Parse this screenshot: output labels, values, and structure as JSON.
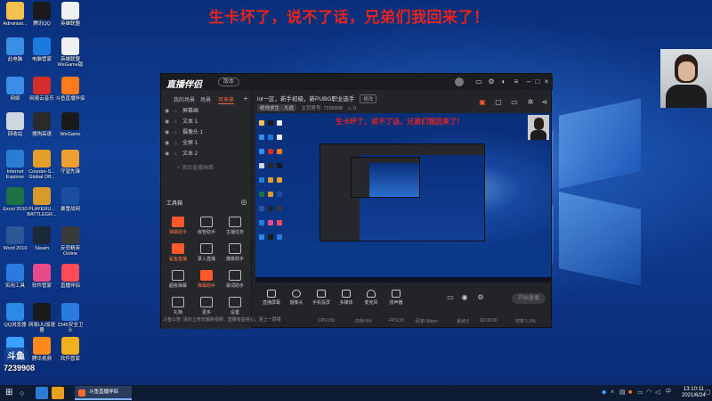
{
  "overlay": {
    "headline": "生卡坏了，说不了话，兄弟们我回来了！",
    "room_id": "7239908",
    "watermark_badge": "斗鱼"
  },
  "desktop": {
    "icons": [
      {
        "label": "Administr...",
        "icon": "user-folder-icon",
        "color": "#f2c14e"
      },
      {
        "label": "腾讯QQ",
        "icon": "qq-icon",
        "color": "#1a1a1a"
      },
      {
        "label": "英雄联盟",
        "icon": "document-icon",
        "color": "#f0f0f0"
      },
      {
        "label": "此电脑",
        "icon": "computer-icon",
        "color": "#3a8ee6"
      },
      {
        "label": "电脑管家",
        "icon": "shield-icon",
        "color": "#1b7ae0"
      },
      {
        "label": "英雄联盟 WeGame版",
        "icon": "document-icon",
        "color": "#f0f0f0"
      },
      {
        "label": "网络",
        "icon": "network-icon",
        "color": "#3a8ee6"
      },
      {
        "label": "网易云音乐",
        "icon": "music-icon",
        "color": "#d62b2b"
      },
      {
        "label": "斗鱼直播伴侣",
        "icon": "douyu-icon",
        "color": "#ff7a1a"
      },
      {
        "label": "回收站",
        "icon": "recycle-bin-icon",
        "color": "#cfd6e0"
      },
      {
        "label": "搜狗高速",
        "icon": "browser-icon",
        "color": "#2a2a2a"
      },
      {
        "label": "WeGame",
        "icon": "wegame-icon",
        "color": "#1a1a1a"
      },
      {
        "label": "Internet Explorer",
        "icon": "ie-icon",
        "color": "#2b7cd3"
      },
      {
        "label": "Counter-S... Global Off...",
        "icon": "csgo-icon",
        "color": "#e2a02a"
      },
      {
        "label": "守望先锋",
        "icon": "overwatch-icon",
        "color": "#f0a030"
      },
      {
        "label": "Excel 2010",
        "icon": "excel-icon",
        "color": "#1e7145"
      },
      {
        "label": "PLAYERU... BATTLEGR...",
        "icon": "pubg-icon",
        "color": "#d89a2a"
      },
      {
        "label": "暴雪战网",
        "icon": "battlenet-icon",
        "color": "#1a4fa0"
      },
      {
        "label": "Word 2010",
        "icon": "word-icon",
        "color": "#2b5797"
      },
      {
        "label": "Steam",
        "icon": "steam-icon",
        "color": "#1b2838"
      },
      {
        "label": "反恐精英 Online",
        "icon": "cso-icon",
        "color": "#3a3a3a"
      },
      {
        "label": "实用工具",
        "icon": "tools-icon",
        "color": "#2a7ae0"
      },
      {
        "label": "软件管家",
        "icon": "software-manager-icon",
        "color": "#e84a8a"
      },
      {
        "label": "直播伴侣",
        "icon": "live-icon",
        "color": "#ff4a5a"
      },
      {
        "label": "QQ浏览器",
        "icon": "qq-browser-icon",
        "color": "#2a8ae6"
      },
      {
        "label": "网易UU加速器",
        "icon": "uu-icon",
        "color": "#1a1a1a"
      },
      {
        "label": "2345安全卫士",
        "icon": "security-icon",
        "color": "#2a7ae0"
      },
      {
        "label": "上网导航",
        "icon": "navigation-icon",
        "color": "#3aa0ff"
      },
      {
        "label": "腾讯视频",
        "icon": "video-icon",
        "color": "#ff8a1a"
      },
      {
        "label": "软件管家",
        "icon": "app-store-icon",
        "color": "#f0b020"
      }
    ]
  },
  "app": {
    "logo": "直播伴侣",
    "version": "版本",
    "left_tabs": [
      "我的场景",
      "场景",
      "可来来"
    ],
    "scenes": [
      "屏幕画",
      "文本 1",
      "摄像头 1",
      "全屏 1",
      "文本 2"
    ],
    "add_source": "+ 添加直播画面",
    "toolbox_label": "工具箱",
    "tools": [
      {
        "label": "弹幕助手",
        "hot": true
      },
      {
        "label": "房管助手",
        "hot": false
      },
      {
        "label": "主播任务",
        "hot": false
      },
      {
        "label": "鲨鱼直播",
        "hot": true
      },
      {
        "label": "录入直播",
        "hot": false
      },
      {
        "label": "摄像助手",
        "hot": false
      },
      {
        "label": "超级弹幕",
        "hot": false
      },
      {
        "label": "弹幕助手",
        "hot": true
      },
      {
        "label": "歌词助手",
        "hot": false
      },
      {
        "label": "礼物",
        "hot": false
      },
      {
        "label": "更多",
        "hot": false
      },
      {
        "label": "设置",
        "hot": false
      }
    ],
    "notice": "斗鱼公告: 请勿上传无版权视频，直播有益身心，更上一层楼",
    "room_title": "lol一区，新手初级，新PUBG职业选手",
    "room_title_edit": "修改",
    "room_meta": {
      "category": "绝地求生 · 大逃",
      "room_label": "主页房号: 7239908",
      "count": "0"
    },
    "preview_headline": "生卡坏了，说不了话，兄弟们我回来了！",
    "bottom_buttons": [
      "直播屏幕",
      "摄像头",
      "手机投屏",
      "多媒体",
      "麦克风",
      "扬声器"
    ],
    "start_live": "开始直播",
    "status": [
      "CPU:0%",
      "内存:0%",
      "FPS:30",
      "码率:0kbps",
      "丢帧:0",
      "00:00:00",
      "效率:1.0%"
    ]
  },
  "taskbar": {
    "active_app": "斗鱼直播伴侣",
    "time": "13:10:11",
    "date": "2021/6/24",
    "tray_language": "中"
  },
  "colors": {
    "headline_red": "#e8231d",
    "accent_orange": "#ff6a3d",
    "app_bg": "#232427"
  }
}
